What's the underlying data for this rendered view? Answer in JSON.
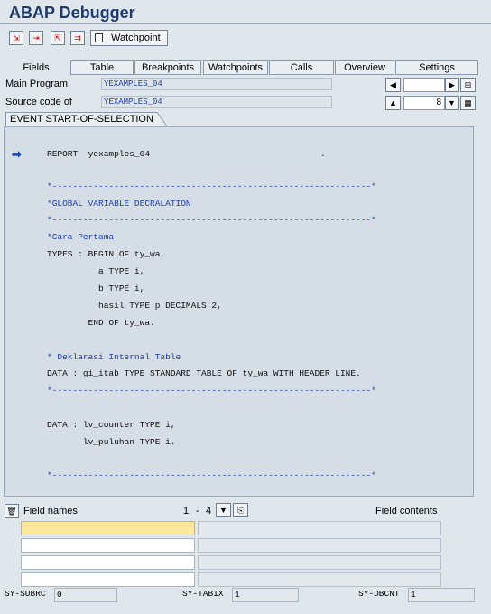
{
  "title": "ABAP Debugger",
  "toolbar": {
    "watchpoint_label": "Watchpoint"
  },
  "tabs": [
    "Fields",
    "Table",
    "Breakpoints",
    "Watchpoints",
    "Calls",
    "Overview",
    "Settings"
  ],
  "main_program": {
    "label": "Main Program",
    "value": "YEXAMPLES_04"
  },
  "source_code": {
    "label": "Source code of",
    "value": "YEXAMPLES_04",
    "line_number": "8"
  },
  "event_tab": "EVENT START-OF-SELECTION",
  "code_lines": [
    "REPORT  yexamples_04",
    "*--------------------------------------------------------------*",
    "*GLOBAL VARIABLE DECRALATION",
    "*--------------------------------------------------------------*",
    "*Cara Pertama",
    "TYPES : BEGIN OF ty_wa,",
    "          a TYPE i,",
    "          b TYPE i,",
    "          hasil TYPE p DECIMALS 2,",
    "        END OF ty_wa.",
    "* Deklarasi Internal Table",
    "DATA : gi_itab TYPE STANDARD TABLE OF ty_wa WITH HEADER LINE.",
    "*--------------------------------------------------------------*",
    "DATA : lv_counter TYPE i,",
    "       lv_puluhan TYPE i.",
    "*--------------------------------------------------------------*"
  ],
  "code_dot": ".",
  "field_names_label": "Field names",
  "field_contents_label": "Field contents",
  "range": {
    "from": "1",
    "sep": "-",
    "to": "4"
  },
  "sy": [
    {
      "label": "SY-SUBRC",
      "value": "0"
    },
    {
      "label": "SY-TABIX",
      "value": "1"
    },
    {
      "label": "SY-DBCNT",
      "value": "1"
    }
  ]
}
